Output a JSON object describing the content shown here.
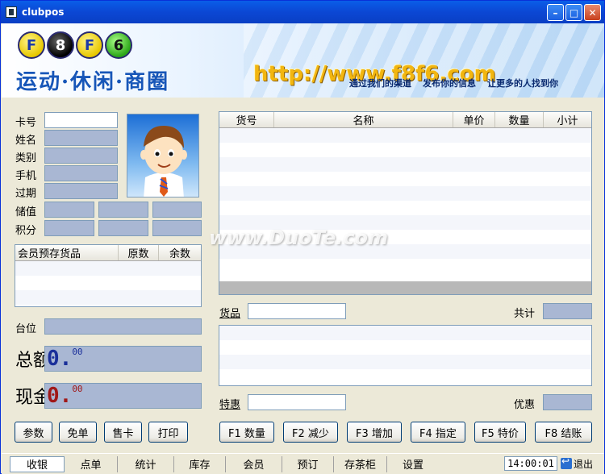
{
  "window": {
    "title": "clubpos"
  },
  "banner": {
    "logo_letters": [
      "F",
      "8",
      "F",
      "6"
    ],
    "slogan": "运动·休闲·商圈",
    "url": "http://www.f8f6.com",
    "taglines": [
      "通过我们的渠道",
      "发布你的信息",
      "让更多的人找到你"
    ]
  },
  "member": {
    "labels": {
      "card": "卡号",
      "name": "姓名",
      "category": "类别",
      "phone": "手机",
      "expire": "过期",
      "stored_value": "储值",
      "points": "积分"
    },
    "card_value": "",
    "stored_goods": {
      "headers": [
        "会员预存货品",
        "原数",
        "余数"
      ],
      "rows": [
        [],
        [],
        []
      ]
    },
    "table_label": "台位"
  },
  "totals": {
    "total_label": "总额",
    "total_main": "0.",
    "total_cents": "00",
    "cash_label": "现金",
    "cash_main": "0.",
    "cash_cents": "00"
  },
  "left_buttons": [
    "参数",
    "免单",
    "售卡",
    "打印"
  ],
  "goods_table": {
    "headers": [
      "货号",
      "名称",
      "单价",
      "数量",
      "小计"
    ],
    "rows": [
      [],
      [],
      [],
      [],
      [],
      [],
      [],
      [],
      [],
      []
    ]
  },
  "goods_label": "货品",
  "sum_label": "共计",
  "special_label": "特惠",
  "discount_label": "优惠",
  "fn_buttons": [
    "F1 数量",
    "F2 减少",
    "F3 增加",
    "F4 指定",
    "F5 特价",
    "F8 结账"
  ],
  "tabs": [
    "收银",
    "点单",
    "统计",
    "库存",
    "会员",
    "预订",
    "存茶柜",
    "设置"
  ],
  "active_tab": "收银",
  "clock": "14:00:01",
  "exit_label": "退出",
  "watermark": "www.DuoTe.com"
}
